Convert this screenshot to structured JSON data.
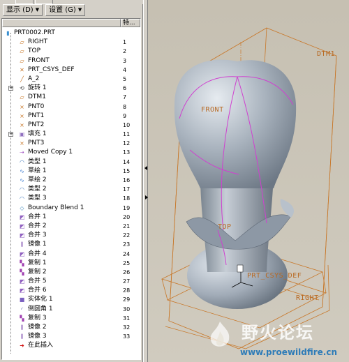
{
  "menubar": {
    "display_label": "显示 (D)",
    "settings_label": "设置 (G)"
  },
  "tree_header": {
    "col2": "特..."
  },
  "tree": {
    "items": [
      {
        "label": "PRT0002.PRT",
        "num": "",
        "icon": "part-icon",
        "indent": 0,
        "expand": false
      },
      {
        "label": "RIGHT",
        "num": "1",
        "icon": "datum-plane-icon",
        "indent": 1,
        "expand": false
      },
      {
        "label": "TOP",
        "num": "2",
        "icon": "datum-plane-icon",
        "indent": 1,
        "expand": false
      },
      {
        "label": "FRONT",
        "num": "3",
        "icon": "datum-plane-icon",
        "indent": 1,
        "expand": false
      },
      {
        "label": "PRT_CSYS_DEF",
        "num": "4",
        "icon": "csys-icon",
        "indent": 1,
        "expand": false
      },
      {
        "label": "A_2",
        "num": "5",
        "icon": "axis-icon",
        "indent": 1,
        "expand": false
      },
      {
        "label": "旋转 1",
        "num": "6",
        "icon": "revolve-icon",
        "indent": 1,
        "expand": true
      },
      {
        "label": "DTM1",
        "num": "7",
        "icon": "datum-plane-icon",
        "indent": 1,
        "expand": false
      },
      {
        "label": "PNT0",
        "num": "8",
        "icon": "datum-point-icon",
        "indent": 1,
        "expand": false
      },
      {
        "label": "PNT1",
        "num": "9",
        "icon": "datum-point-icon",
        "indent": 1,
        "expand": false
      },
      {
        "label": "PNT2",
        "num": "10",
        "icon": "datum-point-icon",
        "indent": 1,
        "expand": false
      },
      {
        "label": "填充 1",
        "num": "11",
        "icon": "fill-icon",
        "indent": 1,
        "expand": true
      },
      {
        "label": "PNT3",
        "num": "12",
        "icon": "datum-point-icon",
        "indent": 1,
        "expand": false
      },
      {
        "label": "Moved Copy 1",
        "num": "13",
        "icon": "moved-copy-icon",
        "indent": 1,
        "expand": false
      },
      {
        "label": "类型 1",
        "num": "14",
        "icon": "type-icon",
        "indent": 1,
        "expand": false
      },
      {
        "label": "草绘 1",
        "num": "15",
        "icon": "sketch-icon",
        "indent": 1,
        "expand": false
      },
      {
        "label": "草绘 2",
        "num": "16",
        "icon": "sketch-icon",
        "indent": 1,
        "expand": false
      },
      {
        "label": "类型 2",
        "num": "17",
        "icon": "type-icon",
        "indent": 1,
        "expand": false
      },
      {
        "label": "类型 3",
        "num": "18",
        "icon": "type-icon",
        "indent": 1,
        "expand": false
      },
      {
        "label": "Boundary Blend 1",
        "num": "19",
        "icon": "boundary-blend-icon",
        "indent": 1,
        "expand": false
      },
      {
        "label": "合并 1",
        "num": "20",
        "icon": "merge-icon",
        "indent": 1,
        "expand": false
      },
      {
        "label": "合并 2",
        "num": "21",
        "icon": "merge-icon",
        "indent": 1,
        "expand": false
      },
      {
        "label": "合并 3",
        "num": "22",
        "icon": "merge-icon",
        "indent": 1,
        "expand": false
      },
      {
        "label": "镜像 1",
        "num": "23",
        "icon": "mirror-icon",
        "indent": 1,
        "expand": false
      },
      {
        "label": "合并 4",
        "num": "24",
        "icon": "merge-icon",
        "indent": 1,
        "expand": false
      },
      {
        "label": "复制 1",
        "num": "25",
        "icon": "copy-icon",
        "indent": 1,
        "expand": false
      },
      {
        "label": "复制 2",
        "num": "26",
        "icon": "copy-icon",
        "indent": 1,
        "expand": false
      },
      {
        "label": "合并 5",
        "num": "27",
        "icon": "merge-icon",
        "indent": 1,
        "expand": false
      },
      {
        "label": "合并 6",
        "num": "28",
        "icon": "merge-icon",
        "indent": 1,
        "expand": false
      },
      {
        "label": "实体化 1",
        "num": "29",
        "icon": "solidify-icon",
        "indent": 1,
        "expand": false
      },
      {
        "label": "倒圆角 1",
        "num": "30",
        "icon": "round-icon",
        "indent": 1,
        "expand": false
      },
      {
        "label": "复制 3",
        "num": "31",
        "icon": "copy-icon",
        "indent": 1,
        "expand": false
      },
      {
        "label": "镜像 2",
        "num": "32",
        "icon": "mirror-icon",
        "indent": 1,
        "expand": false
      },
      {
        "label": "镜像 3",
        "num": "33",
        "icon": "mirror-icon",
        "indent": 1,
        "expand": false
      },
      {
        "label": "在此插入",
        "num": "",
        "icon": "insert-here-icon",
        "indent": 1,
        "expand": false
      }
    ]
  },
  "viewport": {
    "labels": {
      "dtm1": "DTM1",
      "front": "FRONT",
      "top": "TOP",
      "csys": "PRT_CSYS_DEF",
      "right": "RIGHT"
    },
    "watermark": {
      "cn": "野火论坛",
      "url": "www.proewildfire.cn"
    }
  },
  "colors": {
    "datum": "#c8782a",
    "model": "#a9b3bf",
    "curve": "#d040d0",
    "url": "#2e7cb8"
  }
}
